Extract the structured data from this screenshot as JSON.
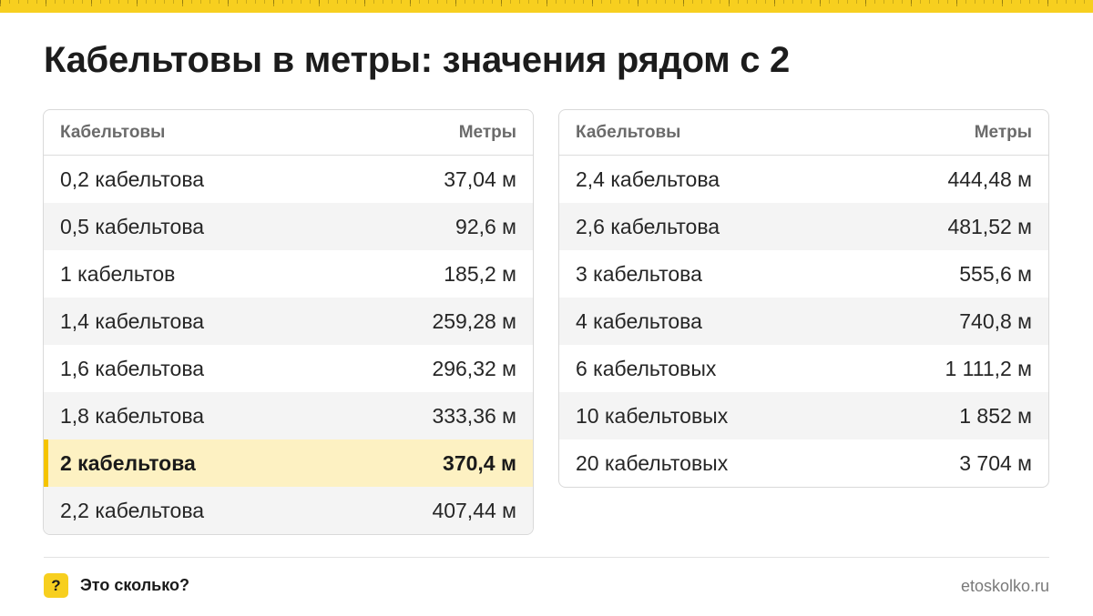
{
  "title": "Кабельтовы в метры: значения рядом с 2",
  "tables": {
    "left": {
      "header": {
        "col1": "Кабельтовы",
        "col2": "Метры"
      },
      "rows": [
        {
          "cab": "0,2 кабельтова",
          "m": "37,04 м"
        },
        {
          "cab": "0,5 кабельтова",
          "m": "92,6 м"
        },
        {
          "cab": "1 кабельтов",
          "m": "185,2 м"
        },
        {
          "cab": "1,4 кабельтова",
          "m": "259,28 м"
        },
        {
          "cab": "1,6 кабельтова",
          "m": "296,32 м"
        },
        {
          "cab": "1,8 кабельтова",
          "m": "333,36 м"
        },
        {
          "cab": "2 кабельтова",
          "m": "370,4 м",
          "highlighted": true
        },
        {
          "cab": "2,2 кабельтова",
          "m": "407,44 м"
        }
      ]
    },
    "right": {
      "header": {
        "col1": "Кабельтовы",
        "col2": "Метры"
      },
      "rows": [
        {
          "cab": "2,4 кабельтова",
          "m": "444,48 м"
        },
        {
          "cab": "2,6 кабельтова",
          "m": "481,52 м"
        },
        {
          "cab": "3 кабельтова",
          "m": "555,6 м"
        },
        {
          "cab": "4 кабельтова",
          "m": "740,8 м"
        },
        {
          "cab": "6 кабельтовых",
          "m": "1 111,2 м"
        },
        {
          "cab": "10 кабельтовых",
          "m": "1 852 м"
        },
        {
          "cab": "20 кабельтовых",
          "m": "3 704 м"
        }
      ]
    }
  },
  "footer": {
    "icon_glyph": "?",
    "icon": "question-mark-icon",
    "brand": "Это сколько?",
    "site": "etoskolko.ru"
  },
  "colors": {
    "accent": "#f7cf1f",
    "highlight_bg": "#fdf1c2",
    "highlight_bar": "#f5c400"
  }
}
